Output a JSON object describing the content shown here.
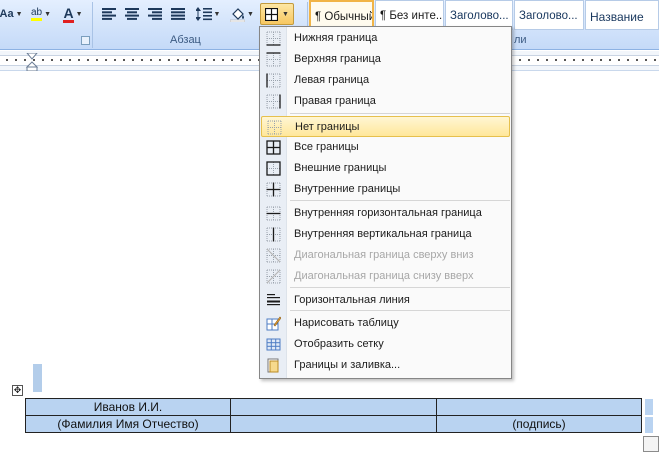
{
  "ribbon": {
    "font_case_label": "Aa",
    "highlight_label": "ab",
    "font_color_label": "A",
    "paragraph_group_label": "Абзац",
    "styles_group_label_tail": "ли",
    "styles": [
      {
        "label": "¶ Обычный"
      },
      {
        "label": "¶ Без инте..."
      },
      {
        "label": "Заголово..."
      },
      {
        "label": "Заголово..."
      },
      {
        "label": "Название"
      }
    ]
  },
  "menu": {
    "items": [
      {
        "label": "Нижняя граница",
        "icon": "bottom-border-icon",
        "enabled": true
      },
      {
        "label": "Верхняя граница",
        "icon": "top-border-icon",
        "enabled": true
      },
      {
        "label": "Левая граница",
        "icon": "left-border-icon",
        "enabled": true
      },
      {
        "label": "Правая граница",
        "icon": "right-border-icon",
        "enabled": true
      },
      {
        "label": "Нет границы",
        "icon": "no-border-icon",
        "enabled": true,
        "highlighted": true
      },
      {
        "label": "Все границы",
        "icon": "all-borders-icon",
        "enabled": true
      },
      {
        "label": "Внешние границы",
        "icon": "outside-borders-icon",
        "enabled": true
      },
      {
        "label": "Внутренние границы",
        "icon": "inside-borders-icon",
        "enabled": true
      },
      {
        "label": "Внутренняя горизонтальная граница",
        "icon": "inside-horizontal-border-icon",
        "enabled": true
      },
      {
        "label": "Внутренняя вертикальная граница",
        "icon": "inside-vertical-border-icon",
        "enabled": true
      },
      {
        "label": "Диагональная граница сверху вниз",
        "icon": "diagonal-down-border-icon",
        "enabled": false
      },
      {
        "label": "Диагональная граница снизу вверх",
        "icon": "diagonal-up-border-icon",
        "enabled": false
      },
      {
        "label": "Горизонтальная линия",
        "icon": "horizontal-line-icon",
        "enabled": true
      },
      {
        "label": "Нарисовать таблицу",
        "icon": "draw-table-icon",
        "enabled": true
      },
      {
        "label": "Отобразить сетку",
        "icon": "view-gridlines-icon",
        "enabled": true
      },
      {
        "label": "Границы и заливка...",
        "icon": "borders-and-shading-icon",
        "enabled": true
      }
    ]
  },
  "table": {
    "rows": [
      [
        "Иванов И.И.",
        "",
        ""
      ],
      [
        "(Фамилия Имя Отчество)",
        "",
        "(подпись)"
      ]
    ]
  },
  "colors": {
    "ribbon_bg": "#d5e5fb",
    "selection": "#b9d3f1",
    "menu_highlight": "#ffe79a"
  }
}
